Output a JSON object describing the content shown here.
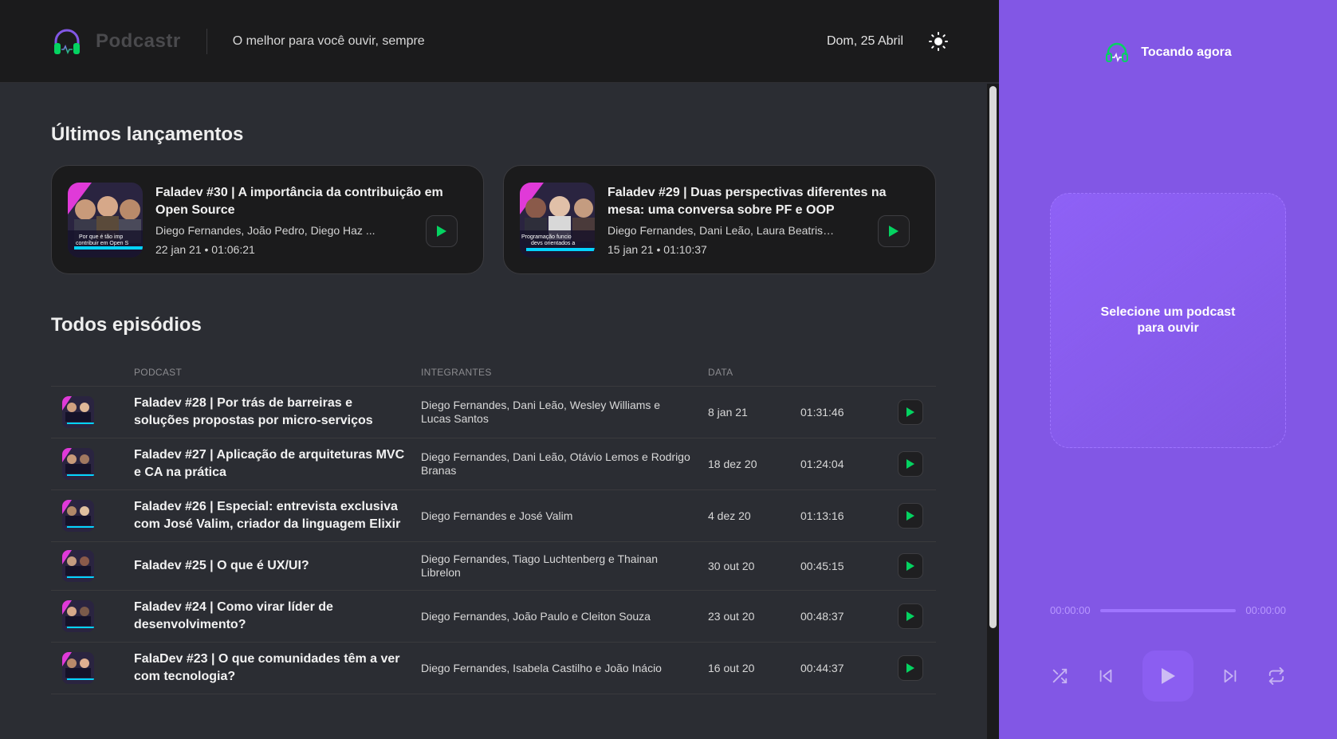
{
  "header": {
    "app_name": "Podcastr",
    "tagline": "O melhor para você ouvir, sempre",
    "date": "Dom, 25 Abril"
  },
  "latest": {
    "title": "Últimos lançamentos",
    "episodes": [
      {
        "title": "Faladev #30 | A importância da contribuição em Open Source",
        "members": "Diego Fernandes, João Pedro, Diego Haz ...",
        "meta": "22 jan 21 • 01:06:21",
        "thumb_text": "Por que é tão imp contribuir em Open S"
      },
      {
        "title": "Faladev #29 | Duas perspectivas diferentes na mesa: uma conversa sobre PF e OOP",
        "members": "Diego Fernandes, Dani Leão, Laura Beatris ...",
        "meta": "15 jan 21 • 01:10:37",
        "thumb_text": "Programação funcio devs orientados a"
      }
    ]
  },
  "all": {
    "title": "Todos episódios",
    "columns": [
      "",
      "Podcast",
      "Integrantes",
      "Data",
      "",
      ""
    ],
    "rows": [
      {
        "title": "Faladev #28 | Por trás de barreiras e soluções propostas por micro-serviços",
        "members": "Diego Fernandes, Dani Leão, Wesley Williams e Lucas Santos",
        "date": "8 jan 21",
        "duration": "01:31:46"
      },
      {
        "title": "Faladev #27 | Aplicação de arquiteturas MVC e CA na prática",
        "members": "Diego Fernandes, Dani Leão, Otávio Lemos e Rodrigo Branas",
        "date": "18 dez 20",
        "duration": "01:24:04"
      },
      {
        "title": "Faladev #26 | Especial: entrevista exclusiva com José Valim, criador da linguagem Elixir",
        "members": "Diego Fernandes e José Valim",
        "date": "4 dez 20",
        "duration": "01:13:16"
      },
      {
        "title": "Faladev #25 | O que é UX/UI?",
        "members": "Diego Fernandes, Tiago Luchtenberg e Thainan Librelon",
        "date": "30 out 20",
        "duration": "00:45:15"
      },
      {
        "title": "Faladev #24 | Como virar líder de desenvolvimento?",
        "members": "Diego Fernandes, João Paulo e Cleiton Souza",
        "date": "23 out 20",
        "duration": "00:48:37"
      },
      {
        "title": "FalaDev #23 | O que comunidades têm a ver com tecnologia?",
        "members": "Diego Fernandes, Isabela Castilho e João Inácio",
        "date": "16 out 20",
        "duration": "00:44:37"
      }
    ]
  },
  "player": {
    "header": "Tocando agora",
    "empty_text": "Selecione um podcast para ouvir",
    "current_time": "00:00:00",
    "total_time": "00:00:00"
  },
  "colors": {
    "accent_purple": "#8257e5",
    "play_green": "#04d361",
    "header_bg": "#1b1b1c",
    "main_bg": "#2b2d33"
  },
  "icons": {
    "logo": "headphones-icon",
    "theme": "sun-icon",
    "play": "play-icon",
    "shuffle": "shuffle-icon",
    "previous": "skip-back-icon",
    "next": "skip-forward-icon",
    "repeat": "repeat-icon"
  }
}
